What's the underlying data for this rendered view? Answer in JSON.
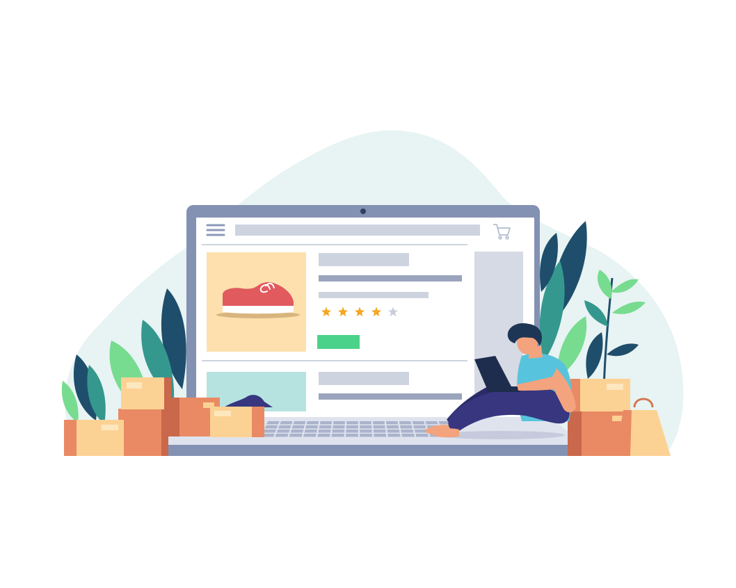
{
  "illustration": {
    "subject": "online-shopping",
    "screen": {
      "menu_icon": "hamburger-menu-icon",
      "cart_icon": "shopping-cart-icon",
      "product_primary": {
        "image_icon": "sneaker-icon",
        "rating": 4,
        "rating_max": 5,
        "buy_button_color": "#4bd28a"
      },
      "product_secondary": {
        "image_icon": "shoe-icon"
      }
    },
    "person": {
      "activity": "using-laptop"
    },
    "decor": [
      "cardboard-box-icon",
      "shopping-bag-icon",
      "leaf-icon"
    ]
  },
  "colors": {
    "background_blob": "#e8f3f3",
    "laptop_frame": "#8391b3",
    "screen_bg": "#ffffff",
    "placeholder": "#ced3e0",
    "product_card_bg": "#fde0ad",
    "sneaker": "#e05a5e",
    "star_on": "#f5a623",
    "star_off": "#c9cedb",
    "leaf_dark": "#1e4e6b",
    "leaf_teal": "#35988f",
    "leaf_light": "#77dc90",
    "box_light": "#fcd294",
    "box_dark": "#e98a64",
    "shirt": "#58c3dc",
    "pants": "#37367f",
    "skin": "#f3a37d",
    "hair": "#1e3656"
  }
}
